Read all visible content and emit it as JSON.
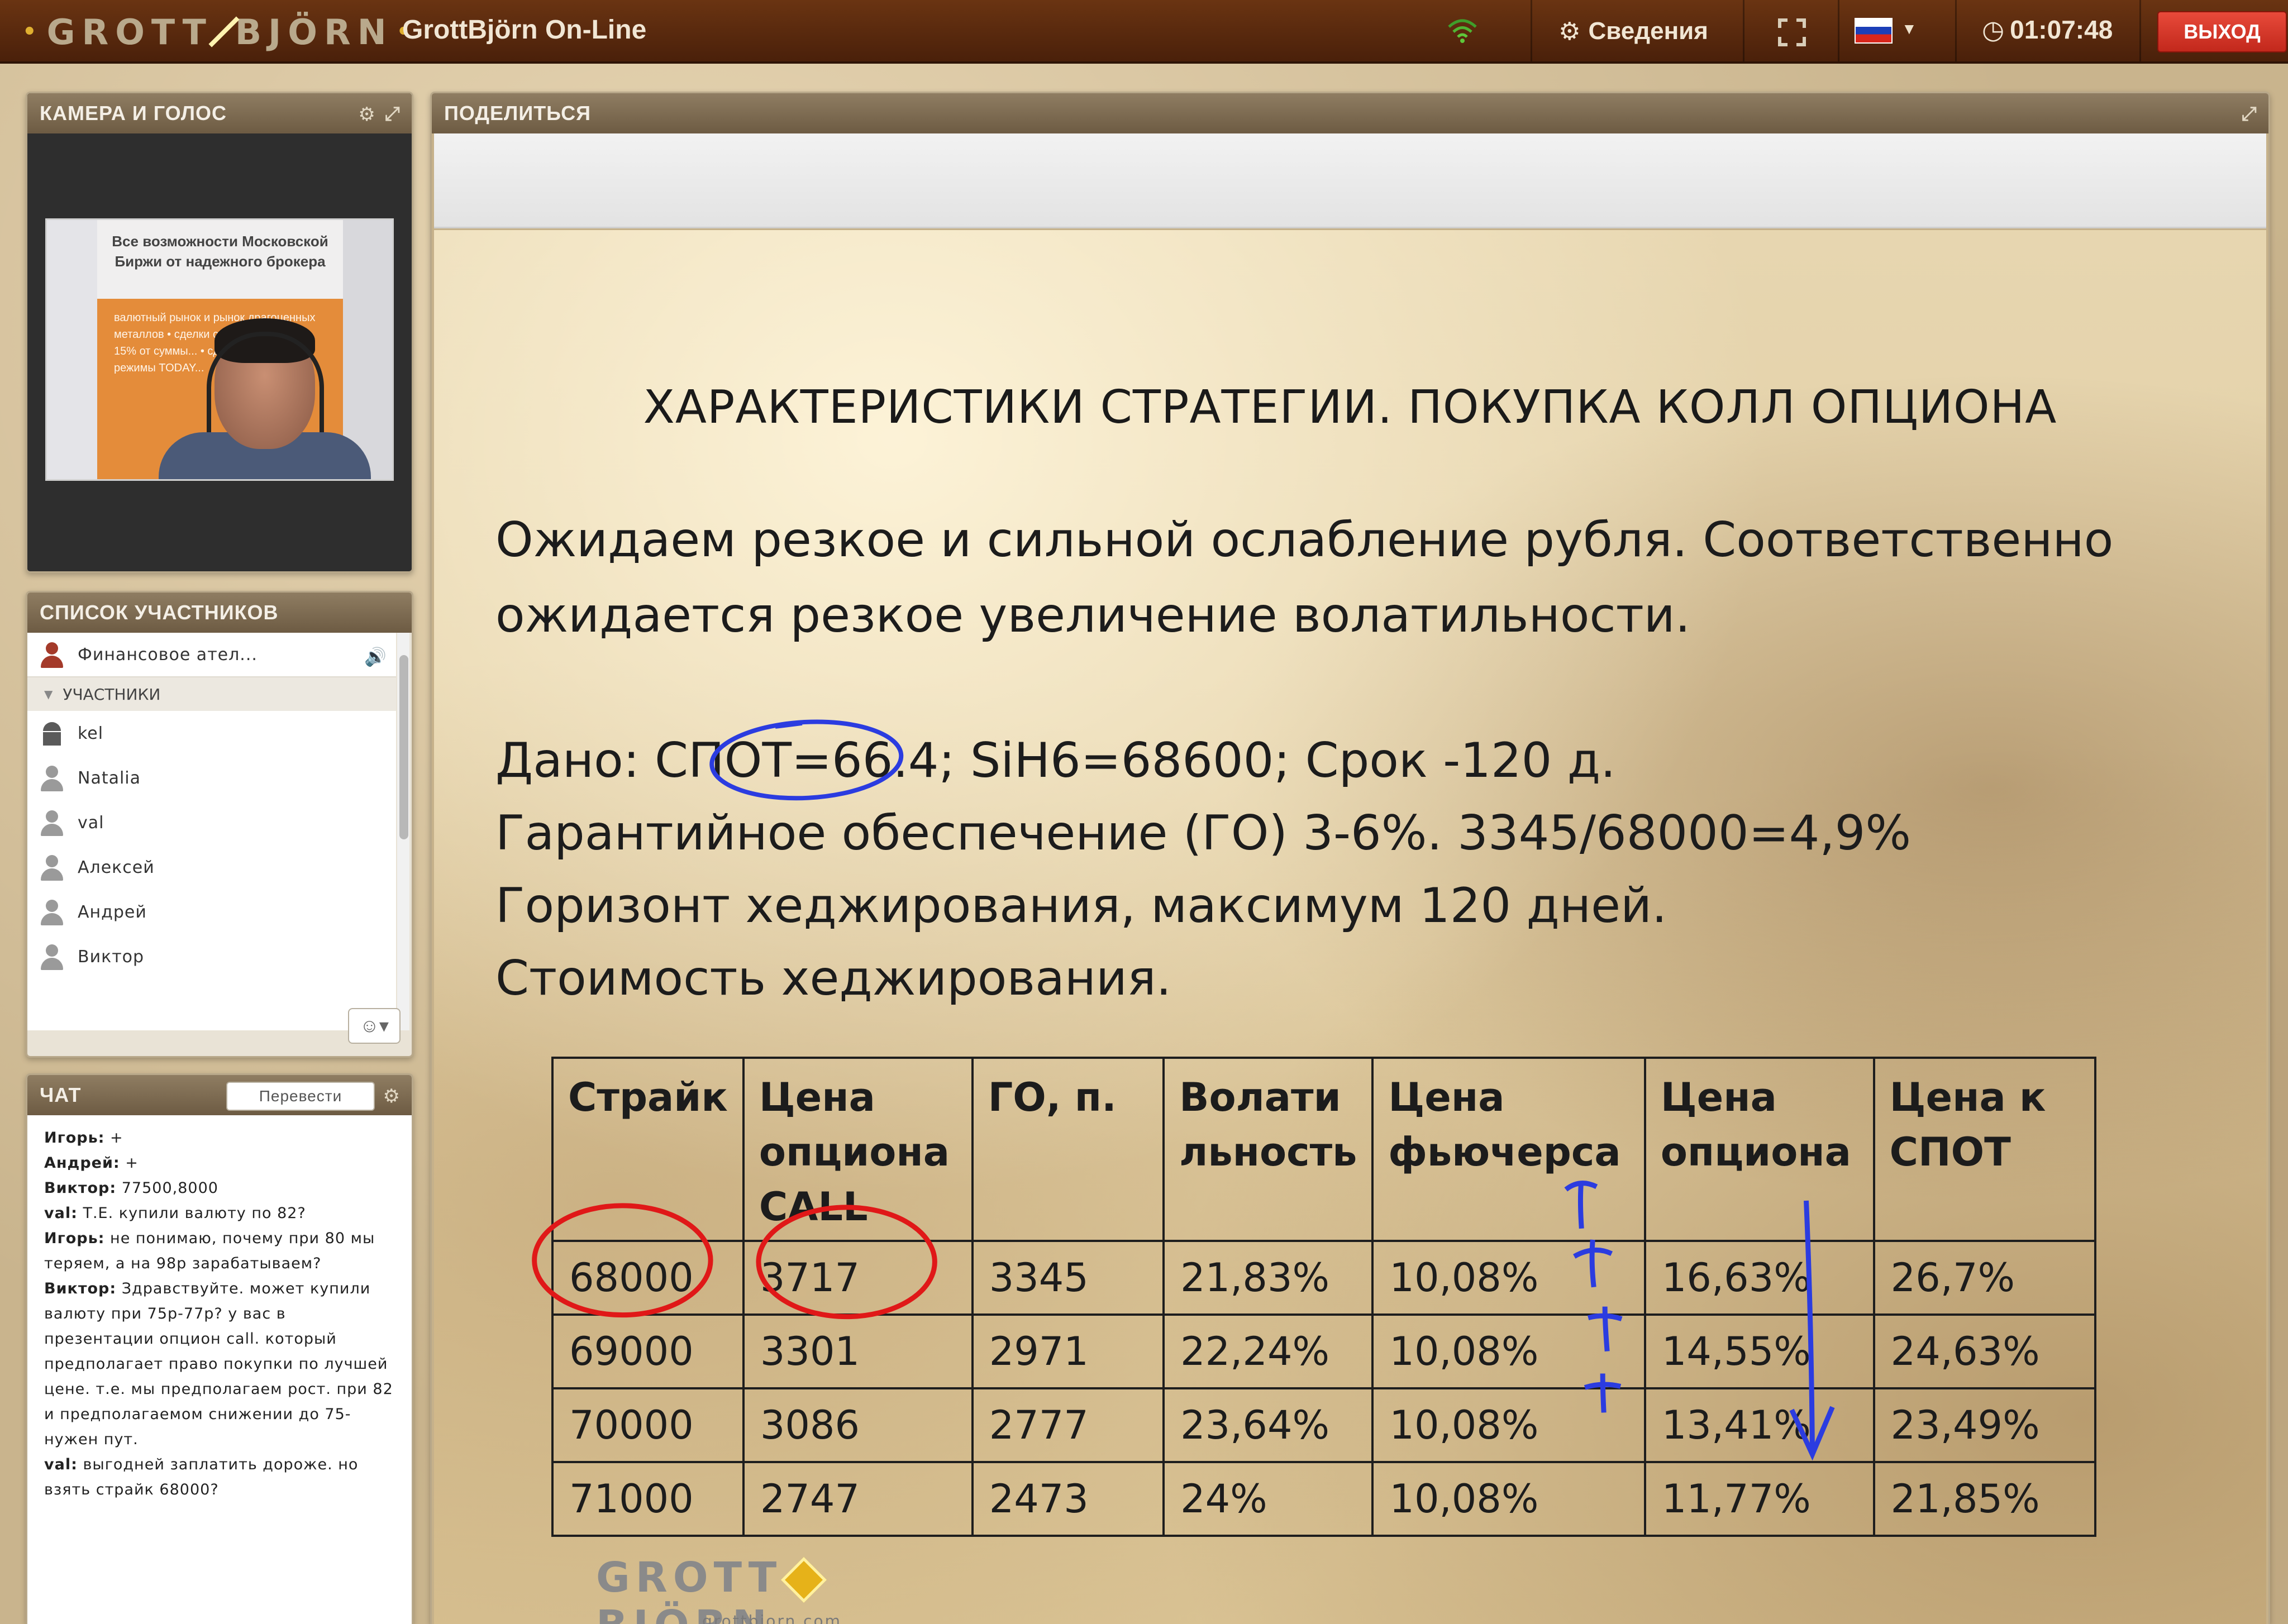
{
  "topbar": {
    "logo_text": "GROTT BJÖRN",
    "app_title": "GrottBjörn On-Line",
    "info_label": "Сведения",
    "timer": "01:07:48",
    "exit_label": "ВЫХОД",
    "language_flag": "ru-flag"
  },
  "camera": {
    "title": "КАМЕРА И ГОЛОС",
    "video_banner_title": "Все возможности Московской Биржи от надежного брокера",
    "video_banner_lines": "валютный рынок и рынок драгоценных металлов • сделки с частичным... • 10-15% от суммы... • сделка SWAP • режимы TODAY..."
  },
  "participants": {
    "title": "СПИСОК УЧАСТНИКОВ",
    "owner": "Финансовое ател...",
    "group_label": "УЧАСТНИКИ",
    "users": [
      "kel",
      "Natalia",
      "val",
      "Алексей",
      "Андрей",
      "Виктор"
    ]
  },
  "chat": {
    "title": "ЧАТ",
    "translate_label": "Перевести",
    "messages": [
      {
        "author": "Игорь:",
        "text": " +"
      },
      {
        "author": "Андрей:",
        "text": " +"
      },
      {
        "author": "Виктор:",
        "text": " 77500,8000"
      },
      {
        "author": "val:",
        "text": " Т.Е. купили валюту по 82?"
      },
      {
        "author": "Игорь:",
        "text": " не понимаю, почему при 80 мы теряем, а на 98р зарабатываем?"
      },
      {
        "author": "Виктор:",
        "text": " Здравствуйте. может купили валюту при 75р-77р? у вас в презентации опцион call. который предполагает право покупки по лучшей цене. т.е. мы предполагаем рост. при 82 и предполагаемом снижении до 75- нужен пут."
      },
      {
        "author": "val:",
        "text": " выгодней заплатить дороже. но взять страйк 68000?"
      }
    ]
  },
  "share": {
    "title": "ПОДЕЛИТЬСЯ"
  },
  "slide": {
    "title": "ХАРАКТЕРИСТИКИ СТРАТЕГИИ. ПОКУПКА КОЛЛ ОПЦИОНА",
    "para1_line1": "Ожидаем резкое и сильной ослабление рубля. Соответственно",
    "para1_line2": "ожидается резкое увеличение волатильности.",
    "given": "Дано: СПОТ=66.4; SiH6=68600; Срок -120 д.",
    "margin": "Гарантийное обеспечение (ГО) 3-6%. 3345/68000=4,9%",
    "horizon": "Горизонт  хеджирования, максимум 120 дней.",
    "cost": "Стоимость хеджирования.",
    "table": {
      "headers": [
        "Страйк",
        "Цена опциона CALL",
        "ГО, п.",
        "Волати льность",
        "Цена фьючерса",
        "Цена опциона",
        "Цена к СПОТ"
      ],
      "rows": [
        [
          "68000",
          "3717",
          "3345",
          "21,83%",
          "10,08%",
          "16,63%",
          "26,7%"
        ],
        [
          "69000",
          "3301",
          "2971",
          "22,24%",
          "10,08%",
          "14,55%",
          "24,63%"
        ],
        [
          "70000",
          "3086",
          "2777",
          "23,64%",
          "10,08%",
          "13,41%",
          "23,49%"
        ],
        [
          "71000",
          "2747",
          "2473",
          "24%",
          "10,08%",
          "11,77%",
          "21,85%"
        ]
      ]
    },
    "logo_text": "GROTT BJÖRN",
    "logo_sub": "grottbjorn.com",
    "annotations": {
      "plus": "+",
      "ink_blue": "#2b3ce0",
      "ink_red": "#e01818"
    }
  }
}
